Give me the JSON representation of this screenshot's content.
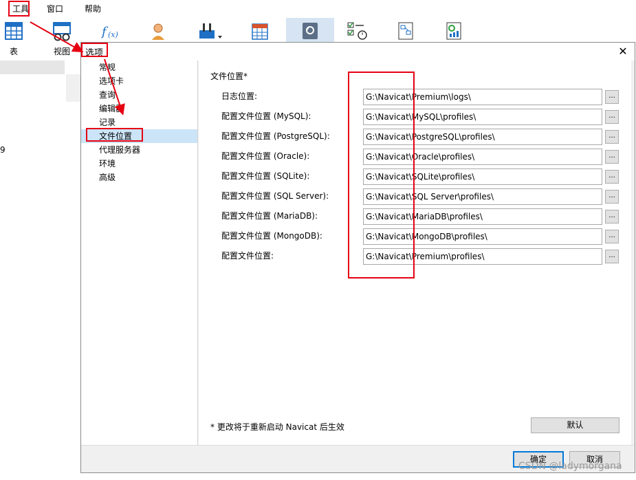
{
  "menu": {
    "items": [
      {
        "label": "工具"
      },
      {
        "label": "窗口"
      },
      {
        "label": "帮助"
      }
    ]
  },
  "toolbar": {
    "table_label": "表",
    "view_label": "视图"
  },
  "background": {
    "stray_text": "9"
  },
  "dialog": {
    "title": "选项",
    "close_glyph": "✕"
  },
  "nav": {
    "items": [
      {
        "label": "常规",
        "selected": false
      },
      {
        "label": "选项卡",
        "selected": false
      },
      {
        "label": "查询",
        "selected": false
      },
      {
        "label": "编辑器",
        "selected": false
      },
      {
        "label": "记录",
        "selected": false
      },
      {
        "label": "文件位置",
        "selected": true
      },
      {
        "label": "代理服务器",
        "selected": false
      },
      {
        "label": "环境",
        "selected": false
      },
      {
        "label": "高级",
        "selected": false
      }
    ]
  },
  "file_location": {
    "section_title": "文件位置*",
    "browse_label": "...",
    "rows": [
      {
        "label": "日志位置:",
        "value": "G:\\Navicat\\Premium\\logs\\"
      },
      {
        "label": "配置文件位置 (MySQL):",
        "value": "G:\\Navicat\\MySQL\\profiles\\"
      },
      {
        "label": "配置文件位置 (PostgreSQL):",
        "value": "G:\\Navicat\\PostgreSQL\\profiles\\"
      },
      {
        "label": "配置文件位置 (Oracle):",
        "value": "G:\\Navicat\\Oracle\\profiles\\"
      },
      {
        "label": "配置文件位置 (SQLite):",
        "value": "G:\\Navicat\\SQLite\\profiles\\"
      },
      {
        "label": "配置文件位置 (SQL Server):",
        "value": "G:\\Navicat\\SQL Server\\profiles\\"
      },
      {
        "label": "配置文件位置 (MariaDB):",
        "value": "G:\\Navicat\\MariaDB\\profiles\\"
      },
      {
        "label": "配置文件位置 (MongoDB):",
        "value": "G:\\Navicat\\MongoDB\\profiles\\"
      },
      {
        "label": "配置文件位置:",
        "value": "G:\\Navicat\\Premium\\profiles\\"
      }
    ],
    "note": "* 更改将于重新启动 Navicat 后生效",
    "default_label": "默认"
  },
  "footer": {
    "ok_label": "确定",
    "cancel_label": "取消"
  },
  "watermark": "CSDN @ladymorgana",
  "colors": {
    "annotation_red": "#e60012",
    "selection_blue": "#cce4f7",
    "focus_blue": "#0078d7"
  }
}
